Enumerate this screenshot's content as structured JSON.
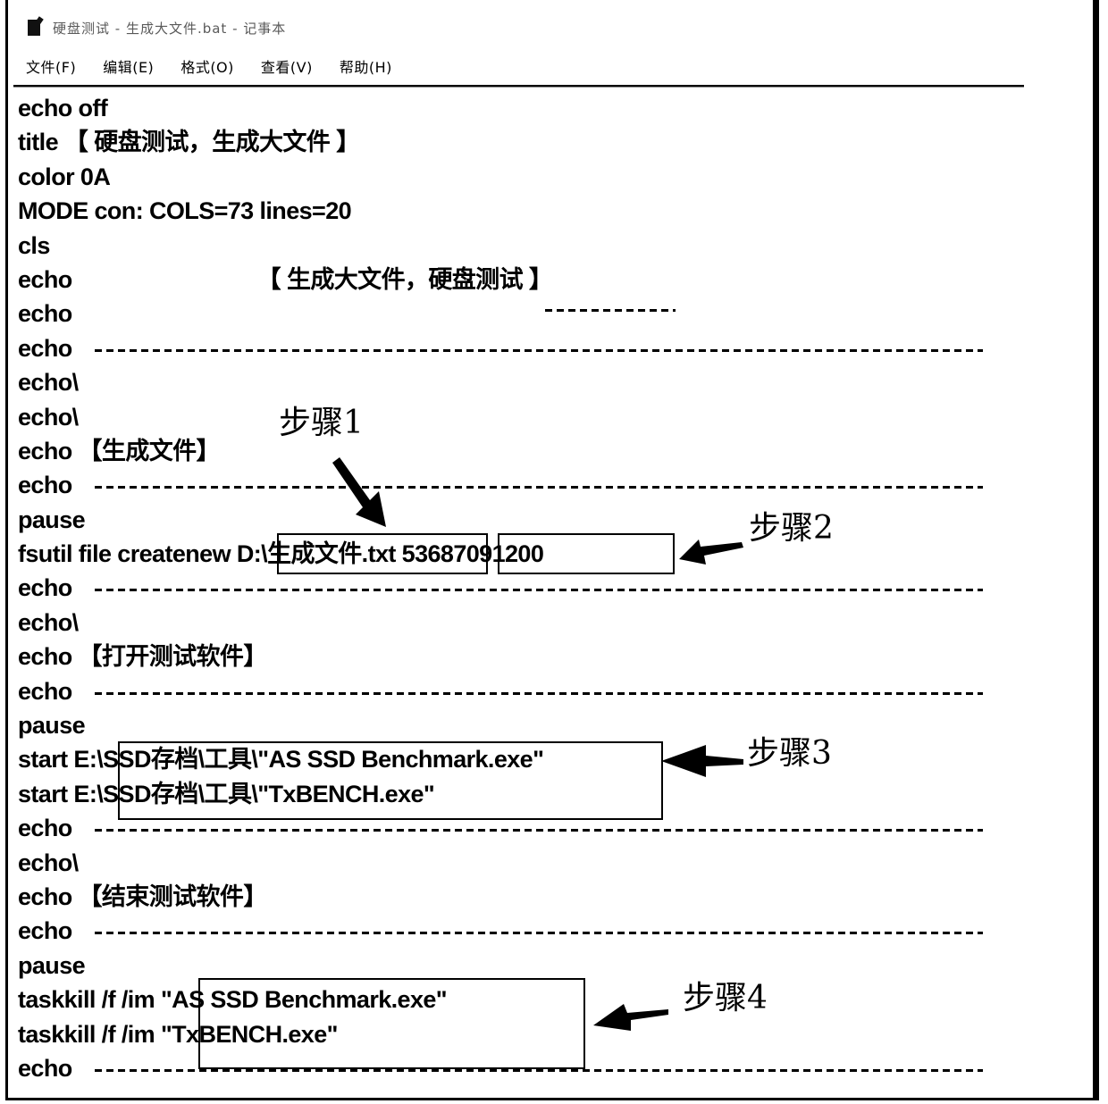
{
  "window": {
    "title": "硬盘测试 - 生成大文件.bat - 记事本",
    "app_icon": "notepad-icon"
  },
  "menubar": {
    "items": [
      {
        "label": "文件(F)"
      },
      {
        "label": "编辑(E)"
      },
      {
        "label": "格式(O)"
      },
      {
        "label": "查看(V)"
      },
      {
        "label": "帮助(H)"
      }
    ]
  },
  "editor": {
    "lines": [
      {
        "text": "echo off"
      },
      {
        "text": "title 【 硬盘测试，生成大文件 】"
      },
      {
        "text": "color 0A"
      },
      {
        "text": "MODE con: COLS=73 lines=20"
      },
      {
        "text": "cls"
      },
      {
        "text": "echo                              【 生成大文件，硬盘测试 】"
      },
      {
        "text": "echo"
      },
      {
        "text": "echo"
      },
      {
        "text": "echo\\"
      },
      {
        "text": "echo\\"
      },
      {
        "text": "echo 【生成文件】"
      },
      {
        "text": "echo"
      },
      {
        "text": "pause"
      },
      {
        "text": "fsutil file createnew D:\\生成文件.txt 53687091200"
      },
      {
        "text": "echo"
      },
      {
        "text": "echo\\"
      },
      {
        "text": "echo 【打开测试软件】"
      },
      {
        "text": "echo"
      },
      {
        "text": "pause"
      },
      {
        "text": "start E:\\SSD存档\\工具\\\"AS SSD Benchmark.exe\""
      },
      {
        "text": "start E:\\SSD存档\\工具\\\"TxBENCH.exe\""
      },
      {
        "text": "echo"
      },
      {
        "text": "echo\\"
      },
      {
        "text": "echo 【结束测试软件】"
      },
      {
        "text": "echo"
      },
      {
        "text": "pause"
      },
      {
        "text": "taskkill /f /im \"AS SSD Benchmark.exe\""
      },
      {
        "text": "taskkill /f /im \"TxBENCH.exe\""
      },
      {
        "text": "echo"
      }
    ]
  },
  "annotations": {
    "step1": {
      "label": "步骤1",
      "target": "D:\\生成文件.txt"
    },
    "step2": {
      "label": "步骤2",
      "target": "53687091200"
    },
    "step3": {
      "label": "步骤3",
      "target": "SSD存档\\工具\\ executables"
    },
    "step4": {
      "label": "步骤4",
      "target": "taskkill process names"
    }
  }
}
